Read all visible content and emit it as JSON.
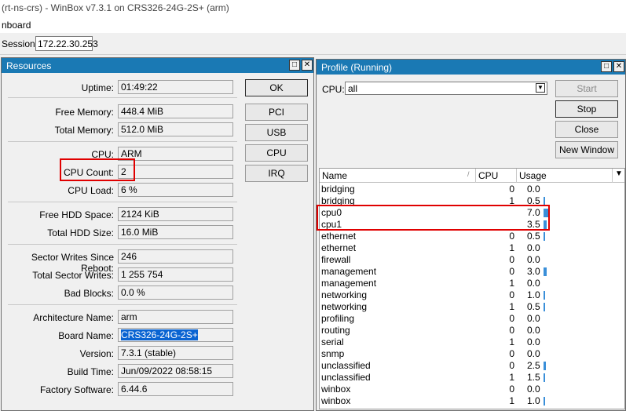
{
  "app": {
    "title": "(rt-ns-crs) - WinBox v7.3.1 on CRS326-24G-2S+ (arm)",
    "menu": "nboard",
    "session_label": "Session:",
    "session_value": "172.22.30.253"
  },
  "resources": {
    "title": "Resources",
    "fields": [
      {
        "label": "Uptime:",
        "value": "01:49:22"
      },
      {
        "label": "Free Memory:",
        "value": "448.4 MiB"
      },
      {
        "label": "Total Memory:",
        "value": "512.0 MiB"
      },
      {
        "label": "CPU:",
        "value": "ARM"
      },
      {
        "label": "CPU Count:",
        "value": "2"
      },
      {
        "label": "CPU Load:",
        "value": "6 %"
      },
      {
        "label": "Free HDD Space:",
        "value": "2124 KiB"
      },
      {
        "label": "Total HDD Size:",
        "value": "16.0 MiB"
      },
      {
        "label": "Sector Writes Since Reboot:",
        "value": "246"
      },
      {
        "label": "Total Sector Writes:",
        "value": "1 255 754"
      },
      {
        "label": "Bad Blocks:",
        "value": "0.0 %"
      },
      {
        "label": "Architecture Name:",
        "value": "arm"
      },
      {
        "label": "Board Name:",
        "value": "CRS326-24G-2S+"
      },
      {
        "label": "Version:",
        "value": "7.3.1 (stable)"
      },
      {
        "label": "Build Time:",
        "value": "Jun/09/2022 08:58:15"
      },
      {
        "label": "Factory Software:",
        "value": "6.44.6"
      }
    ],
    "buttons": {
      "ok": "OK",
      "pci": "PCI",
      "usb": "USB",
      "cpu": "CPU",
      "irq": "IRQ"
    }
  },
  "profile": {
    "title": "Profile (Running)",
    "cpu_label": "CPU:",
    "cpu_value": "all",
    "buttons": {
      "start": "Start",
      "stop": "Stop",
      "close": "Close",
      "new_window": "New Window"
    },
    "columns": {
      "name": "Name",
      "cpu": "CPU",
      "usage": "Usage"
    },
    "rows": [
      {
        "name": "bridging",
        "cpu": "0",
        "usage": "0.0",
        "bar": 0.0
      },
      {
        "name": "bridging",
        "cpu": "1",
        "usage": "0.5",
        "bar": 0.5
      },
      {
        "name": "cpu0",
        "cpu": "",
        "usage": "7.0",
        "bar": 7.0
      },
      {
        "name": "cpu1",
        "cpu": "",
        "usage": "3.5",
        "bar": 3.5
      },
      {
        "name": "ethernet",
        "cpu": "0",
        "usage": "0.5",
        "bar": 0.5
      },
      {
        "name": "ethernet",
        "cpu": "1",
        "usage": "0.0",
        "bar": 0.0
      },
      {
        "name": "firewall",
        "cpu": "0",
        "usage": "0.0",
        "bar": 0.0
      },
      {
        "name": "management",
        "cpu": "0",
        "usage": "3.0",
        "bar": 3.0
      },
      {
        "name": "management",
        "cpu": "1",
        "usage": "0.0",
        "bar": 0.0
      },
      {
        "name": "networking",
        "cpu": "0",
        "usage": "1.0",
        "bar": 1.0
      },
      {
        "name": "networking",
        "cpu": "1",
        "usage": "0.5",
        "bar": 0.5
      },
      {
        "name": "profiling",
        "cpu": "0",
        "usage": "0.0",
        "bar": 0.0
      },
      {
        "name": "routing",
        "cpu": "0",
        "usage": "0.0",
        "bar": 0.0
      },
      {
        "name": "serial",
        "cpu": "1",
        "usage": "0.0",
        "bar": 0.0
      },
      {
        "name": "snmp",
        "cpu": "0",
        "usage": "0.0",
        "bar": 0.0
      },
      {
        "name": "unclassified",
        "cpu": "0",
        "usage": "2.5",
        "bar": 2.5
      },
      {
        "name": "unclassified",
        "cpu": "1",
        "usage": "1.5",
        "bar": 1.5
      },
      {
        "name": "winbox",
        "cpu": "0",
        "usage": "0.0",
        "bar": 0.0
      },
      {
        "name": "winbox",
        "cpu": "1",
        "usage": "1.0",
        "bar": 1.0
      }
    ]
  },
  "colors": {
    "title_bar": "#1a79b4",
    "highlight_box": "#e00000",
    "usage_bar": "#3a8fd9",
    "selection": "#0a64d2"
  }
}
